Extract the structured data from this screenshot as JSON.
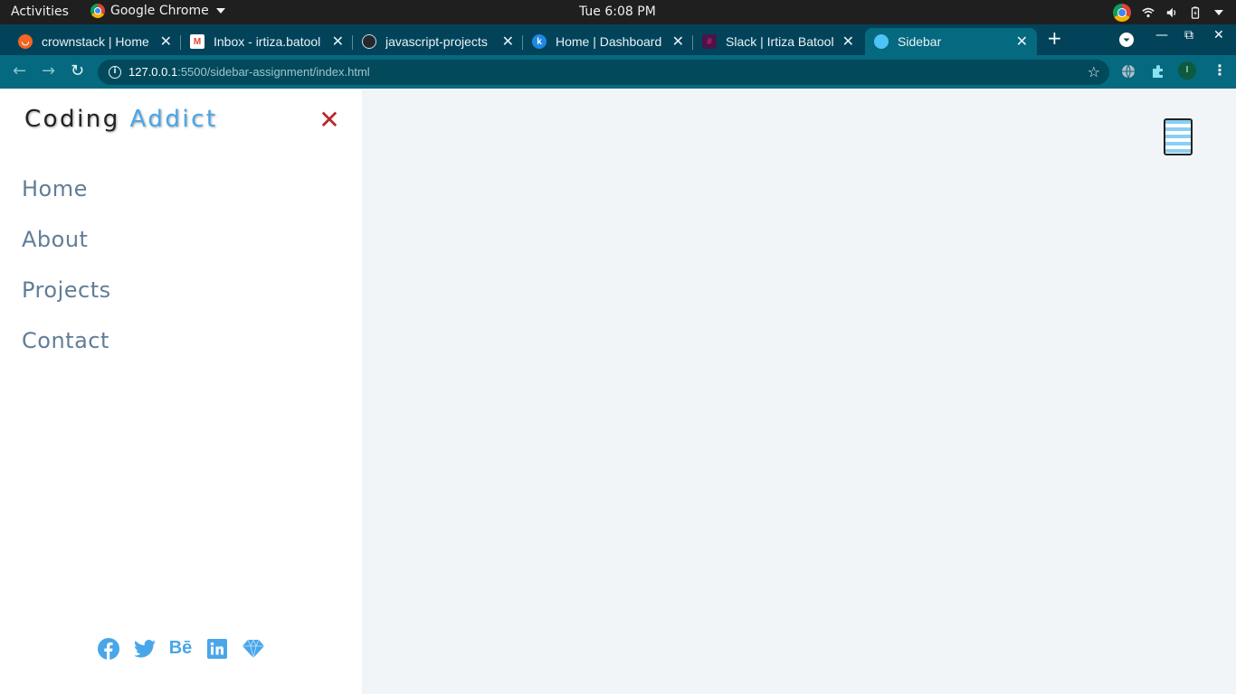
{
  "system": {
    "activities": "Activities",
    "app_name": "Google Chrome",
    "clock": "Tue  6:08 PM"
  },
  "tabs": [
    {
      "title": "crownstack | Home",
      "favicon_color": "#f26522"
    },
    {
      "title": "Inbox - irtiza.batool",
      "favicon_color": "#ea4335"
    },
    {
      "title": "javascript-projects",
      "favicon_color": "#24292e"
    },
    {
      "title": "Home | Dashboard",
      "favicon_color": "#1e88e5"
    },
    {
      "title": "Slack | Irtiza Batool",
      "favicon_color": "#4a154b"
    },
    {
      "title": "Sidebar",
      "favicon_color": "#4fc3f7"
    }
  ],
  "address_bar": {
    "host": "127.0.0.1",
    "path": ":5500/sidebar-assignment/index.html"
  },
  "profile_initial": "I",
  "sidebar": {
    "logo_primary": "Coding",
    "logo_accent": "Addict",
    "links": [
      "Home",
      "About",
      "Projects",
      "Contact"
    ],
    "social": [
      "facebook-icon",
      "twitter-icon",
      "behance-icon",
      "linkedin-icon",
      "sketch-icon"
    ]
  },
  "colors": {
    "accent": "#49a6e9",
    "close": "#bb2525",
    "link": "#617d98",
    "page_bg": "#f1f5f8"
  }
}
